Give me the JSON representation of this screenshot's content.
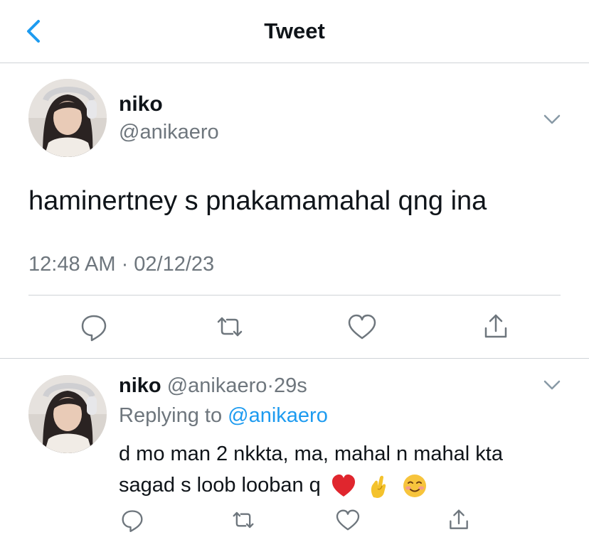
{
  "header": {
    "title": "Tweet",
    "back_icon": "chevron-left-icon",
    "accent": "#1d9bf0"
  },
  "tweet": {
    "name": "niko",
    "handle": "@anikaero",
    "text": "haminertney s pnakamamahal qng ina",
    "timestamp": "12:48 AM · 02/12/23",
    "actions": [
      "reply-icon",
      "retweet-icon",
      "like-icon",
      "share-icon"
    ]
  },
  "reply": {
    "name": "niko",
    "handle": "@anikaero",
    "dot": "·",
    "time": "29s",
    "replying_prefix": "Replying to",
    "replying_handle": "@anikaero",
    "line1": "d mo man 2 nkkta, ma, mahal n mahal kta",
    "line2": "sagad s loob looban q",
    "emojis": [
      "red-heart-emoji",
      "pinching-hand-emoji",
      "smiling-face-emoji"
    ],
    "actions": [
      "reply-icon",
      "retweet-icon",
      "like-icon",
      "share-icon"
    ]
  },
  "colors": {
    "text": "#0f1419",
    "secondary": "#6e767d",
    "link": "#1d9bf0",
    "divider": "#cfd3d7"
  }
}
